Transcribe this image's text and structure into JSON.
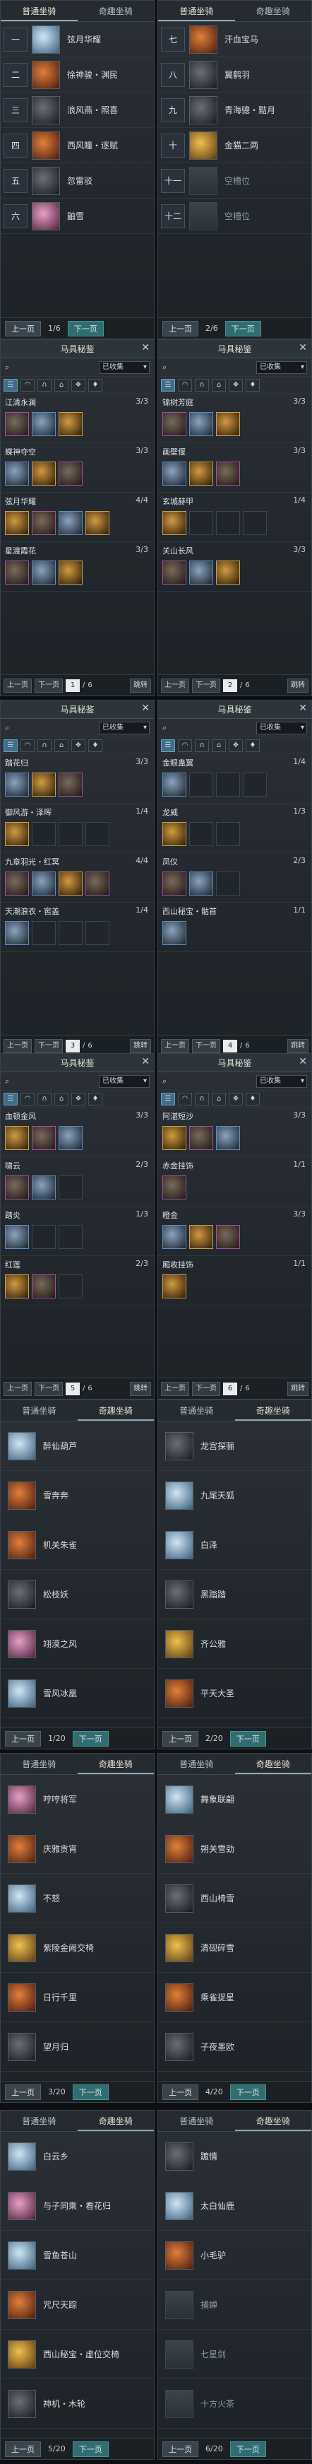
{
  "common": {
    "tab_normal": "普通坐骑",
    "tab_special": "奇趣坐骑",
    "prev": "上一页",
    "next": "下一页",
    "gallery_title": "马具秘鉴",
    "filter_collected": "已收集",
    "first": "上一页",
    "next2": "下一页",
    "jump": "跳转"
  },
  "s1": {
    "left": {
      "page": "1/6",
      "rows": [
        {
          "badge": "一",
          "name": "弦月华耀",
          "ico": "ice"
        },
        {
          "badge": "二",
          "name": "徐神骏・渊民",
          "ico": "fire"
        },
        {
          "badge": "三",
          "name": "浪风燕・照喜",
          "ico": "dark"
        },
        {
          "badge": "四",
          "name": "西风瞳・逐赋",
          "ico": "fire"
        },
        {
          "badge": "五",
          "name": "忽雷驳",
          "ico": "dark"
        },
        {
          "badge": "六",
          "name": "鼬雪",
          "ico": "pink"
        }
      ]
    },
    "right": {
      "page": "2/6",
      "rows": [
        {
          "badge": "七",
          "name": "汗血宝马",
          "ico": "fire"
        },
        {
          "badge": "八",
          "name": "翼鹤羽",
          "ico": "dark"
        },
        {
          "badge": "九",
          "name": "青海骢・黠月",
          "ico": "dark"
        },
        {
          "badge": "十",
          "name": "金猫二两",
          "ico": "gold"
        },
        {
          "badge": "十一",
          "name": "空槽位",
          "ico": "grey",
          "dim": true
        },
        {
          "badge": "十二",
          "name": "空槽位",
          "ico": "grey",
          "dim": true
        }
      ]
    }
  },
  "s2": {
    "left": {
      "page": "1",
      "total": "6",
      "sets": [
        {
          "name": "江清永澜",
          "count": "3/3"
        },
        {
          "name": "蝶神夺空",
          "count": "3/3"
        },
        {
          "name": "弦月华耀",
          "count": "4/4"
        },
        {
          "name": "星渡霞花",
          "count": "3/3"
        }
      ]
    },
    "right": {
      "page": "2",
      "total": "6",
      "sets": [
        {
          "name": "锦树芳庭",
          "count": "3/3"
        },
        {
          "name": "画壁偃",
          "count": "3/3"
        },
        {
          "name": "玄城赫甲",
          "count": "1/4"
        },
        {
          "name": "关山长风",
          "count": "3/3"
        }
      ]
    }
  },
  "s3": {
    "left": {
      "page": "3",
      "total": "6",
      "sets": [
        {
          "name": "踏花归",
          "count": "3/3"
        },
        {
          "name": "御风游・泽晖",
          "count": "1/4"
        },
        {
          "name": "九章羽光・红冥",
          "count": "4/4"
        },
        {
          "name": "天潮浪衣・窖盖",
          "count": "1/4"
        }
      ]
    },
    "right": {
      "page": "4",
      "total": "6",
      "sets": [
        {
          "name": "金眼蛊翼",
          "count": "1/4"
        },
        {
          "name": "龙威",
          "count": "1/3"
        },
        {
          "name": "凤仪",
          "count": "2/3"
        },
        {
          "name": "西山秘宝・骷首",
          "count": "1/1"
        }
      ]
    }
  },
  "s4": {
    "left": {
      "page": "5",
      "total": "6",
      "sets": [
        {
          "name": "血顿金风",
          "count": "3/3"
        },
        {
          "name": "啸云",
          "count": "2/3"
        },
        {
          "name": "踏炎",
          "count": "1/3"
        },
        {
          "name": "红莲",
          "count": "2/3"
        }
      ]
    },
    "right": {
      "page": "6",
      "total": "6",
      "sets": [
        {
          "name": "阿湛短沙",
          "count": "3/3"
        },
        {
          "name": "赤金挂饰",
          "count": "1/1"
        },
        {
          "name": "瞪金",
          "count": "3/3"
        },
        {
          "name": "厢收挂饰",
          "count": "1/1"
        }
      ]
    }
  },
  "s5": {
    "left": {
      "page": "1/20",
      "rows": [
        {
          "name": "醉仙葫芦",
          "ico": "ice"
        },
        {
          "name": "雪奔奔",
          "ico": "fire"
        },
        {
          "name": "机关朱雀",
          "ico": "fire"
        },
        {
          "name": "松枝妖",
          "ico": "dark"
        },
        {
          "name": "翊漠之风",
          "ico": "pink"
        },
        {
          "name": "雪风冰凰",
          "ico": "ice"
        }
      ]
    },
    "right": {
      "page": "2/20",
      "rows": [
        {
          "name": "龙宫探骊",
          "ico": "dark"
        },
        {
          "name": "九尾天狐",
          "ico": "ice"
        },
        {
          "name": "白泽",
          "ico": "ice"
        },
        {
          "name": "黑踏踏",
          "ico": "dark"
        },
        {
          "name": "齐公雅",
          "ico": "gold"
        },
        {
          "name": "平天大圣",
          "ico": "fire"
        }
      ]
    }
  },
  "s6": {
    "left": {
      "page": "3/20",
      "rows": [
        {
          "name": "哼哼将军",
          "ico": "pink"
        },
        {
          "name": "庆雅贪宵",
          "ico": "fire"
        },
        {
          "name": "不怒",
          "ico": "ice"
        },
        {
          "name": "紫陵金阙交椅",
          "ico": "gold"
        },
        {
          "name": "日行千里",
          "ico": "fire"
        },
        {
          "name": "望月归",
          "ico": "dark"
        }
      ]
    },
    "right": {
      "page": "4/20",
      "rows": [
        {
          "name": "舞象联翩",
          "ico": "ice"
        },
        {
          "name": "朔关雪劲",
          "ico": "fire"
        },
        {
          "name": "西山椅雪",
          "ico": "dark"
        },
        {
          "name": "清砚碎雪",
          "ico": "gold"
        },
        {
          "name": "乘雀捉星",
          "ico": "fire"
        },
        {
          "name": "子夜墨欧",
          "ico": "dark"
        }
      ]
    }
  },
  "s7": {
    "left": {
      "page": "5/20",
      "rows": [
        {
          "name": "白云乡",
          "ico": "ice"
        },
        {
          "name": "与子同乘・看花归",
          "ico": "pink"
        },
        {
          "name": "雪鱼苍山",
          "ico": "ice"
        },
        {
          "name": "咒尺天踪",
          "ico": "fire"
        },
        {
          "name": "西山秘宝・虚位交椅",
          "ico": "gold"
        },
        {
          "name": "神机・木轮",
          "ico": "dark"
        }
      ]
    },
    "right": {
      "page": "6/20",
      "rows": [
        {
          "name": "踱情",
          "ico": "dark"
        },
        {
          "name": "太白仙鹿",
          "ico": "ice"
        },
        {
          "name": "小毛驴",
          "ico": "fire"
        },
        {
          "name": "捕蝉",
          "ico": "grey",
          "dim": true
        },
        {
          "name": "七星剑",
          "ico": "grey",
          "dim": true
        },
        {
          "name": "十方火茶",
          "ico": "grey",
          "dim": true
        }
      ]
    }
  }
}
